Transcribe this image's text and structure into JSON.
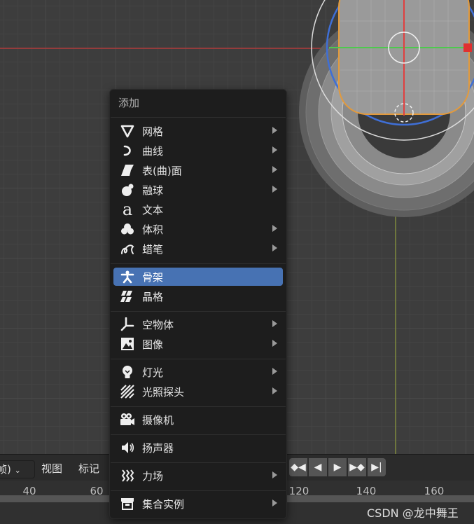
{
  "menu": {
    "title": "添加",
    "items": [
      {
        "label": "网格",
        "icon": "mesh-icon",
        "submenu": true
      },
      {
        "label": "曲线",
        "icon": "curve-icon",
        "submenu": true
      },
      {
        "label": "表(曲)面",
        "icon": "surface-icon",
        "submenu": true
      },
      {
        "label": "融球",
        "icon": "metaball-icon",
        "submenu": true
      },
      {
        "label": "文本",
        "icon": "text-icon",
        "submenu": false
      },
      {
        "label": "体积",
        "icon": "volume-icon",
        "submenu": true
      },
      {
        "label": "蜡笔",
        "icon": "grease-pencil-icon",
        "submenu": true
      },
      {
        "label": "骨架",
        "icon": "armature-icon",
        "submenu": false,
        "highlighted": true
      },
      {
        "label": "晶格",
        "icon": "lattice-icon",
        "submenu": false
      },
      {
        "label": "空物体",
        "icon": "empty-icon",
        "submenu": true
      },
      {
        "label": "图像",
        "icon": "image-icon",
        "submenu": true
      },
      {
        "label": "灯光",
        "icon": "light-icon",
        "submenu": true
      },
      {
        "label": "光照探头",
        "icon": "light-probe-icon",
        "submenu": true
      },
      {
        "label": "摄像机",
        "icon": "camera-icon",
        "submenu": false
      },
      {
        "label": "扬声器",
        "icon": "speaker-icon",
        "submenu": false
      },
      {
        "label": "力场",
        "icon": "force-field-icon",
        "submenu": true
      },
      {
        "label": "集合实例",
        "icon": "collection-instance-icon",
        "submenu": true
      }
    ]
  },
  "timeline": {
    "mode_dropdown": "帧)",
    "view_menu": "视图",
    "marker_menu": "标记",
    "ticks": [
      "40",
      "60",
      "120",
      "140",
      "160"
    ],
    "playback_buttons": [
      "jump-keyframe-icon",
      "play-reverse-icon",
      "play-icon",
      "next-keyframe-icon",
      "jump-end-icon"
    ]
  },
  "watermark": "CSDN @龙中舞王",
  "colors": {
    "menu_bg": "#1d1d1d",
    "highlight": "#4772b3",
    "viewport_bg": "#3d3d3d",
    "x_axis": "#b23b3b",
    "y_axis": "#8b9a3a",
    "selection_outline": "#e39a3c",
    "circle_blue": "#3f6fd6"
  }
}
